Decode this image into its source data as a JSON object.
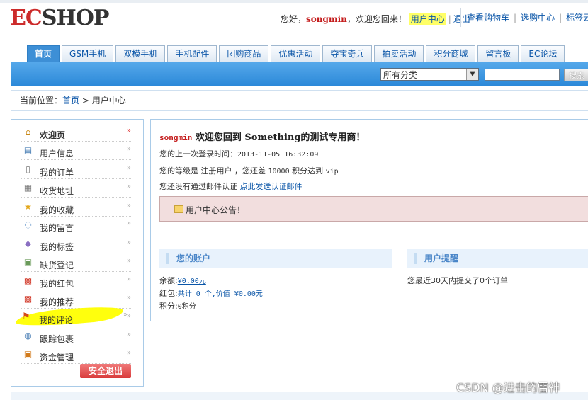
{
  "header": {
    "logo_ec": "EC",
    "logo_rest": "SHOP",
    "greeting": "您好，",
    "username": "songmin",
    "welcome_back": "，欢迎您回来！",
    "user_center": "用户中心",
    "logout": "退出",
    "links": [
      "查看购物车",
      "选购中心",
      "标签云"
    ]
  },
  "nav": {
    "tabs": [
      "首页",
      "GSM手机",
      "双模手机",
      "手机配件",
      "团购商品",
      "优惠活动",
      "夺宝奇兵",
      "拍卖活动",
      "积分商城",
      "留言板",
      "EC论坛"
    ]
  },
  "search": {
    "category": "所有分类",
    "button": "搜索"
  },
  "breadcrumb": {
    "prefix": "当前位置：",
    "home": "首页",
    "sep": " > ",
    "current": "用户中心"
  },
  "sidebar": {
    "items": [
      {
        "label": "欢迎页",
        "icon": "home-icon"
      },
      {
        "label": "用户信息",
        "icon": "id-card-icon"
      },
      {
        "label": "我的订单",
        "icon": "document-icon"
      },
      {
        "label": "收货地址",
        "icon": "address-book-icon"
      },
      {
        "label": "我的收藏",
        "icon": "star-icon"
      },
      {
        "label": "我的留言",
        "icon": "speech-bubble-icon"
      },
      {
        "label": "我的标签",
        "icon": "tag-icon"
      },
      {
        "label": "缺货登记",
        "icon": "clipboard-icon"
      },
      {
        "label": "我的红包",
        "icon": "red-envelope-icon"
      },
      {
        "label": "我的推荐",
        "icon": "recommend-icon"
      },
      {
        "label": "我的评论",
        "icon": "flag-icon"
      },
      {
        "label": "跟踪包裹",
        "icon": "magnifier-icon"
      },
      {
        "label": "资金管理",
        "icon": "wallet-icon"
      }
    ],
    "logout_button": "安全退出"
  },
  "main": {
    "welcome_user": "songmin",
    "welcome_text": " 欢迎您回到 Something的测试专用商！",
    "last_login_label": "您的上一次登录时间：",
    "last_login_value": "2013-11-05 16:32:09",
    "level_text_1": "您的等级是 注册用户 ，您还差 ",
    "level_points": "10000",
    "level_text_2": " 积分达到 ",
    "level_target": "vip",
    "email_text": "您还没有通过邮件认证 ",
    "email_link": "点此发送认证邮件",
    "notice": "用户中心公告！",
    "account_title": "您的账户",
    "balance_label": "余额:",
    "balance_value": "¥0.00元",
    "bonus_label": "红包:",
    "bonus_value": "共计 0 个,价值 ¥0.00元",
    "points_label": "积分:",
    "points_value": "0积分",
    "reminder_title": "用户提醒",
    "reminder_text": "您最近30天内提交了0个订单"
  },
  "watermark": "CSDN @进击的雷神",
  "colors": {
    "nav_blue": "#3d8fd6",
    "highlight": "#ffff00",
    "logout_red": "#d93b3b",
    "username_red": "#c41c1c"
  }
}
